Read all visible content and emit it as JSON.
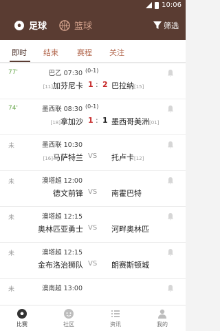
{
  "status_bar": {
    "time": "10:06"
  },
  "header": {
    "sports": [
      {
        "label": "足球",
        "active": true
      },
      {
        "label": "篮球",
        "active": false
      }
    ],
    "filter_label": "筛选"
  },
  "tabs": [
    "即时",
    "结束",
    "赛程",
    "关注"
  ],
  "matches": [
    {
      "status": "77'",
      "league": "巴乙",
      "time": "07:30",
      "half": "(0-1)",
      "home": "加芬尼卡",
      "home_rank": "[11]",
      "away": "巴拉纳",
      "away_rank": "[15]",
      "score": [
        "1",
        ":",
        "2"
      ],
      "vs": ""
    },
    {
      "status": "74'",
      "league": "墨西联",
      "time": "08:30",
      "half": "(0-1)",
      "home": "拿加沙",
      "home_rank": "[18]",
      "away": "墨西哥美洲",
      "away_rank": "[01]",
      "score": [
        "1",
        ":",
        "1"
      ],
      "vs": ""
    },
    {
      "status": "未",
      "league": "墨西联",
      "time": "10:30",
      "half": "",
      "home": "马萨特兰",
      "home_rank": "[16]",
      "away": "托卢卡",
      "away_rank": "[12]",
      "score": [
        "",
        "",
        ""
      ],
      "vs": "VS"
    },
    {
      "status": "未",
      "league": "澳塔超",
      "time": "12:00",
      "half": "",
      "home": "德文前锋",
      "home_rank": "",
      "away": "南霍巴特",
      "away_rank": "",
      "score": [
        "",
        "",
        ""
      ],
      "vs": "VS"
    },
    {
      "status": "未",
      "league": "澳塔超",
      "time": "12:15",
      "half": "",
      "home": "奥林匹亚勇士",
      "home_rank": "",
      "away": "河畔奥林匹",
      "away_rank": "",
      "score": [
        "",
        "",
        ""
      ],
      "vs": "VS"
    },
    {
      "status": "未",
      "league": "澳塔超",
      "time": "12:15",
      "half": "",
      "home": "金布洛治狮队",
      "home_rank": "",
      "away": "朗赛斯顿城",
      "away_rank": "",
      "score": [
        "",
        "",
        ""
      ],
      "vs": "VS"
    },
    {
      "status": "未",
      "league": "澳南超",
      "time": "13:00",
      "half": "",
      "home": "",
      "home_rank": "",
      "away": "",
      "away_rank": "",
      "score": [
        "",
        "",
        ""
      ],
      "vs": ""
    }
  ],
  "bottom_nav": [
    {
      "label": "比赛",
      "icon": "soccer-ball-icon",
      "active": true
    },
    {
      "label": "社区",
      "icon": "community-icon",
      "active": false
    },
    {
      "label": "资讯",
      "icon": "news-list-icon",
      "active": false
    },
    {
      "label": "我的",
      "icon": "profile-icon",
      "active": false
    }
  ],
  "colors": {
    "header_bg": "#5a3c32",
    "accent": "#b46b52",
    "live_green": "#6aa84f",
    "score_red": "#c62828"
  }
}
